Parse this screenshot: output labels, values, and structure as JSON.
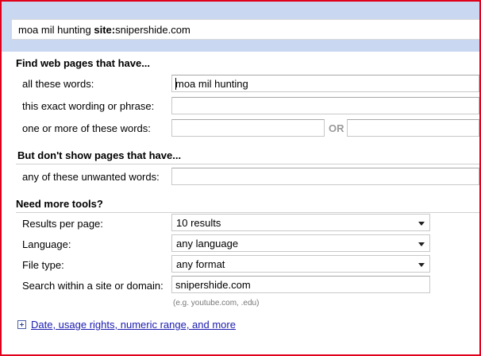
{
  "query": {
    "terms": "moa mil hunting ",
    "operator": "site:",
    "site": "snipershide.com"
  },
  "find_section": {
    "title": "Find web pages that have...",
    "all_words_label": "all these words:",
    "all_words_value": "moa mil hunting",
    "exact_phrase_label": "this exact wording or phrase:",
    "exact_phrase_value": "",
    "any_words_label": "one or more of these words:",
    "any_words_value_1": "",
    "or_label": "OR",
    "any_words_value_2": ""
  },
  "exclude_section": {
    "title": "But don't show pages that have...",
    "unwanted_label": "any of these unwanted words:",
    "unwanted_value": ""
  },
  "tools_section": {
    "title": "Need more tools?",
    "results_label": "Results per page:",
    "results_value": "10 results",
    "language_label": "Language:",
    "language_value": "any language",
    "filetype_label": "File type:",
    "filetype_value": "any format",
    "site_label": "Search within a site or domain:",
    "site_value": "snipershide.com",
    "site_hint": "(e.g. youtube.com, .edu)"
  },
  "more_options": {
    "link_label": "Date, usage rights, numeric range, and more",
    "icon": "plus-box-icon"
  },
  "colors": {
    "frame_border": "#e0001b",
    "top_band": "#c9d7f1",
    "link": "#1a1ab0"
  }
}
